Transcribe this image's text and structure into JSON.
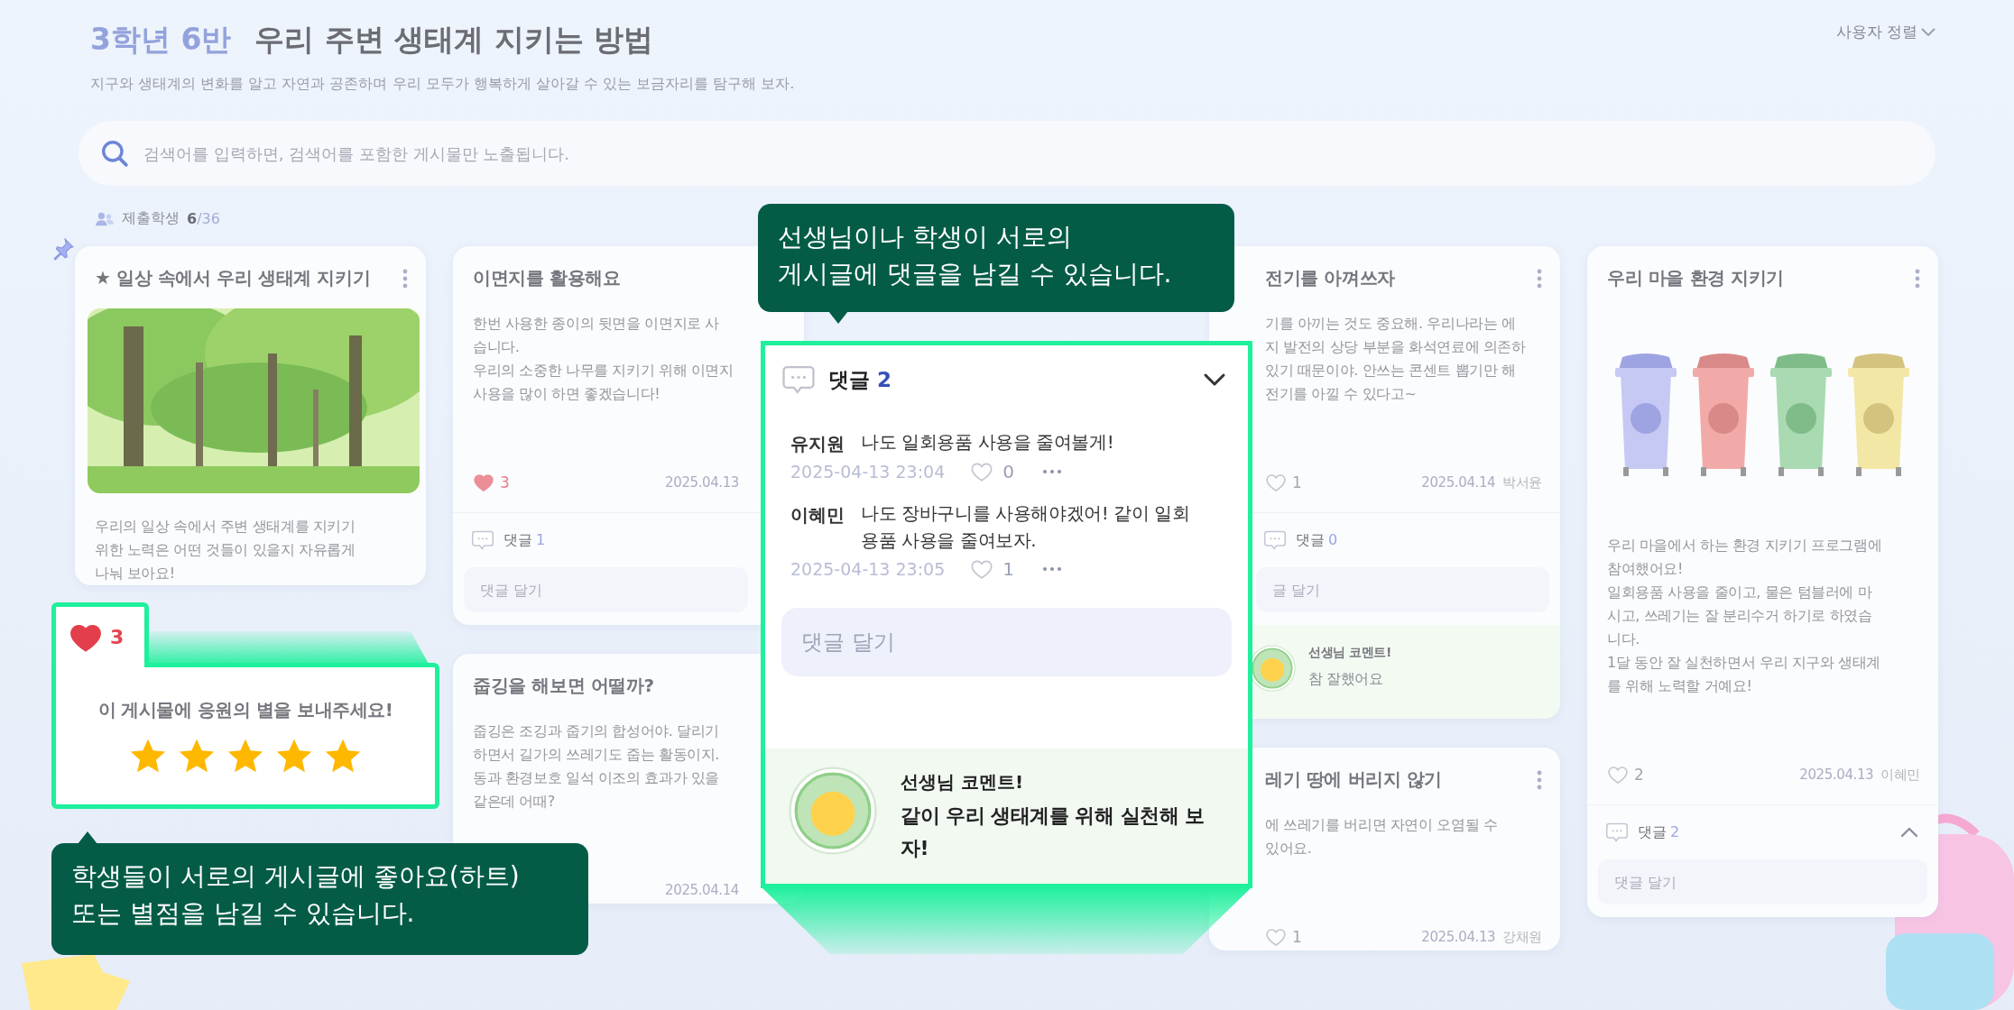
{
  "header": {
    "class_name": "3학년 6반",
    "title": "우리 주변 생태계 지키는 방법",
    "subtitle": "지구와 생태계의 변화를 알고 자연과 공존하며 우리 모두가 행복하게 살아갈 수 있는 보금자리를 탐구해 보자.",
    "sort": "사용자 정렬"
  },
  "search": {
    "placeholder": "검색어를 입력하면, 검색어를 포함한 게시물만 노출됩니다."
  },
  "submitted": {
    "label": "제출학생",
    "count": "6",
    "total": "/36"
  },
  "columns": [
    {
      "cards": [
        {
          "pinned": true,
          "menu": true,
          "title": "★ 일상 속에서 우리 생태계 지키기",
          "body": "우리의 일상 속에서 주변 생태계를 지키기\n위한 노력은 어떤 것들이 있을지 자유롭게\n나눠 보아요!"
        }
      ]
    },
    {
      "cards": [
        {
          "pinned": false,
          "menu": false,
          "title": "이면지를 활용해요",
          "body": "한번 사용한 종이의 뒷면을 이면지로 사\n습니다.\n우리의 소중한 나무를 지키기 위해 이면지\n사용을 많이 하면 좋겠습니다!",
          "likes": "3",
          "liked": true,
          "date": "2025.04.13",
          "comments": {
            "label": "댓글",
            "count": "1",
            "placeholder": "댓글 달기"
          }
        },
        {
          "pinned": false,
          "menu": false,
          "title": "줍깅을 해보면 어떨까?",
          "body": "줍깅은 조깅과 줍기의 합성어야. 달리기\n하면서 길가의 쓰레기도 줍는 활동이지.\n동과 환경보호 일석 이조의 효과가 있을\n같은데 어때?",
          "date": "2025.04.14"
        }
      ]
    },
    {},
    {
      "cards": [
        {
          "pinned": false,
          "menu": true,
          "title": "전기를 아껴쓰자",
          "body": "기를 아끼는 것도 중요해. 우리나라는 에\n지 발전의 상당 부분을 화석연료에 의존하\n있기 때문이야. 안쓰는 콘센트 뽑기만 해\n전기를 아낄 수 있다고~",
          "likes": "1",
          "liked": false,
          "date": "2025.04.14",
          "author": "박서윤",
          "comments": {
            "label": "댓글",
            "count": "0",
            "placeholder": "글 달기"
          },
          "teacher_comment": {
            "label": "선생님 코멘트!",
            "text": "참 잘했어요"
          }
        },
        {
          "pinned": false,
          "menu": true,
          "title": "레기 땅에 버리지 않기",
          "body": "에 쓰레기를 버리면 자연이 오염될 수\n있어요.",
          "likes": "1",
          "liked": false,
          "date": "2025.04.13",
          "author": "강채원"
        }
      ]
    },
    {
      "cards": [
        {
          "pinned": false,
          "menu": true,
          "title": "우리 마을 환경 지키기",
          "media": {
            "kind": "drawing"
          },
          "body": "우리 마을에서 하는 환경 지키기 프로그램에\n참여했어요!\n일회용품 사용을 줄이고, 물은 텀블러에 마\n시고, 쓰레기는 잘 분리수거 하기로 하였습\n니다.\n1달 동안 잘 실천하면서 우리 지구와 생태계\n를 위해 노력할 거예요!",
          "likes": "2",
          "liked": false,
          "date": "2025.04.13",
          "author": "이혜민",
          "comments": {
            "label": "댓글",
            "count": "2",
            "expanded": false,
            "placeholder": "댓글 달기"
          }
        }
      ]
    }
  ],
  "comment_panel": {
    "label": "댓글",
    "count": "2",
    "expanded": true,
    "comments": [
      {
        "author": "유지원",
        "text": "나도 일회용품 사용을 줄여볼게!",
        "time": "2025-04-13 23:04",
        "likes": "0"
      },
      {
        "author": "이혜민",
        "text": "나도 장바구니를 사용해야겠어! 같이 일회\n용품 사용을 줄여보자.",
        "time": "2025-04-13 23:05",
        "likes": "1"
      }
    ],
    "placeholder": "댓글 달기",
    "teacher_comment": {
      "label": "선생님 코멘트!",
      "text": "같이 우리 생태계를 위해 실천해 보\n자!"
    }
  },
  "star_popup": {
    "likes": "3",
    "liked": true,
    "prompt": "이 게시물에 응원의 별을 보내주세요!",
    "stars": 5
  },
  "tooltips": [
    {
      "text": "선생님이나 학생이 서로의\n게시글에 댓글을 남길 수 있습니다."
    },
    {
      "text": "학생들이 서로의 게시글에 좋아요(하트)\n또는 별점을 남길 수 있습니다."
    }
  ]
}
